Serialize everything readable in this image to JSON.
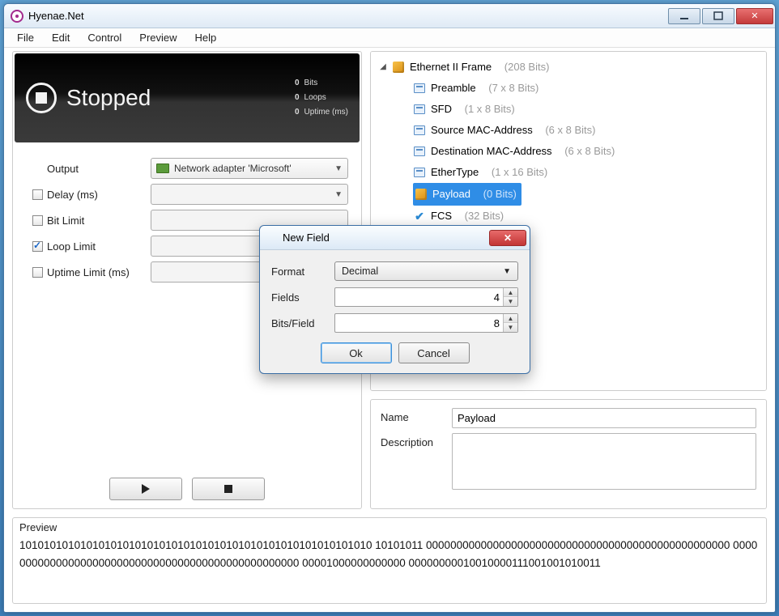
{
  "window": {
    "title": "Hyenae.Net"
  },
  "menu": {
    "file": "File",
    "edit": "Edit",
    "control": "Control",
    "preview": "Preview",
    "help": "Help"
  },
  "status": {
    "label": "Stopped",
    "bits_v": "0",
    "bits_l": "Bits",
    "loops_v": "0",
    "loops_l": "Loops",
    "uptime_v": "0",
    "uptime_l": "Uptime (ms)"
  },
  "form": {
    "output_label": "Output",
    "output_value": "Network adapter 'Microsoft'",
    "delay_label": "Delay (ms)",
    "bitlimit_label": "Bit Limit",
    "looplimit_label": "Loop Limit",
    "uptimelimit_label": "Uptime Limit (ms)"
  },
  "tree": {
    "root_label": "Ethernet II Frame",
    "root_bits": "(208 Bits)",
    "preamble": "Preamble",
    "preamble_bits": "(7 x 8 Bits)",
    "sfd": "SFD",
    "sfd_bits": "(1 x 8 Bits)",
    "srcmac": "Source MAC-Address",
    "srcmac_bits": "(6 x 8 Bits)",
    "dstmac": "Destination MAC-Address",
    "dstmac_bits": "(6 x 8 Bits)",
    "ethertype": "EtherType",
    "ethertype_bits": "(1 x 16 Bits)",
    "payload": "Payload",
    "payload_bits": "(0 Bits)",
    "fcs": "FCS",
    "fcs_bits": "(32 Bits)"
  },
  "props": {
    "name_label": "Name",
    "name_value": "Payload",
    "desc_label": "Description",
    "desc_value": ""
  },
  "preview": {
    "title": "Preview",
    "text": "1010101010101010101010101010101010101010101010101010101010  10101011  00000000000000000000000000000000000000000000000000  00000000000000000000000000000000000000000000000000  00001000000000000  00000000010010000111001001010011"
  },
  "modal": {
    "title": "New Field",
    "format_label": "Format",
    "format_value": "Decimal",
    "fields_label": "Fields",
    "fields_value": "4",
    "bits_label": "Bits/Field",
    "bits_value": "8",
    "ok": "Ok",
    "cancel": "Cancel"
  }
}
